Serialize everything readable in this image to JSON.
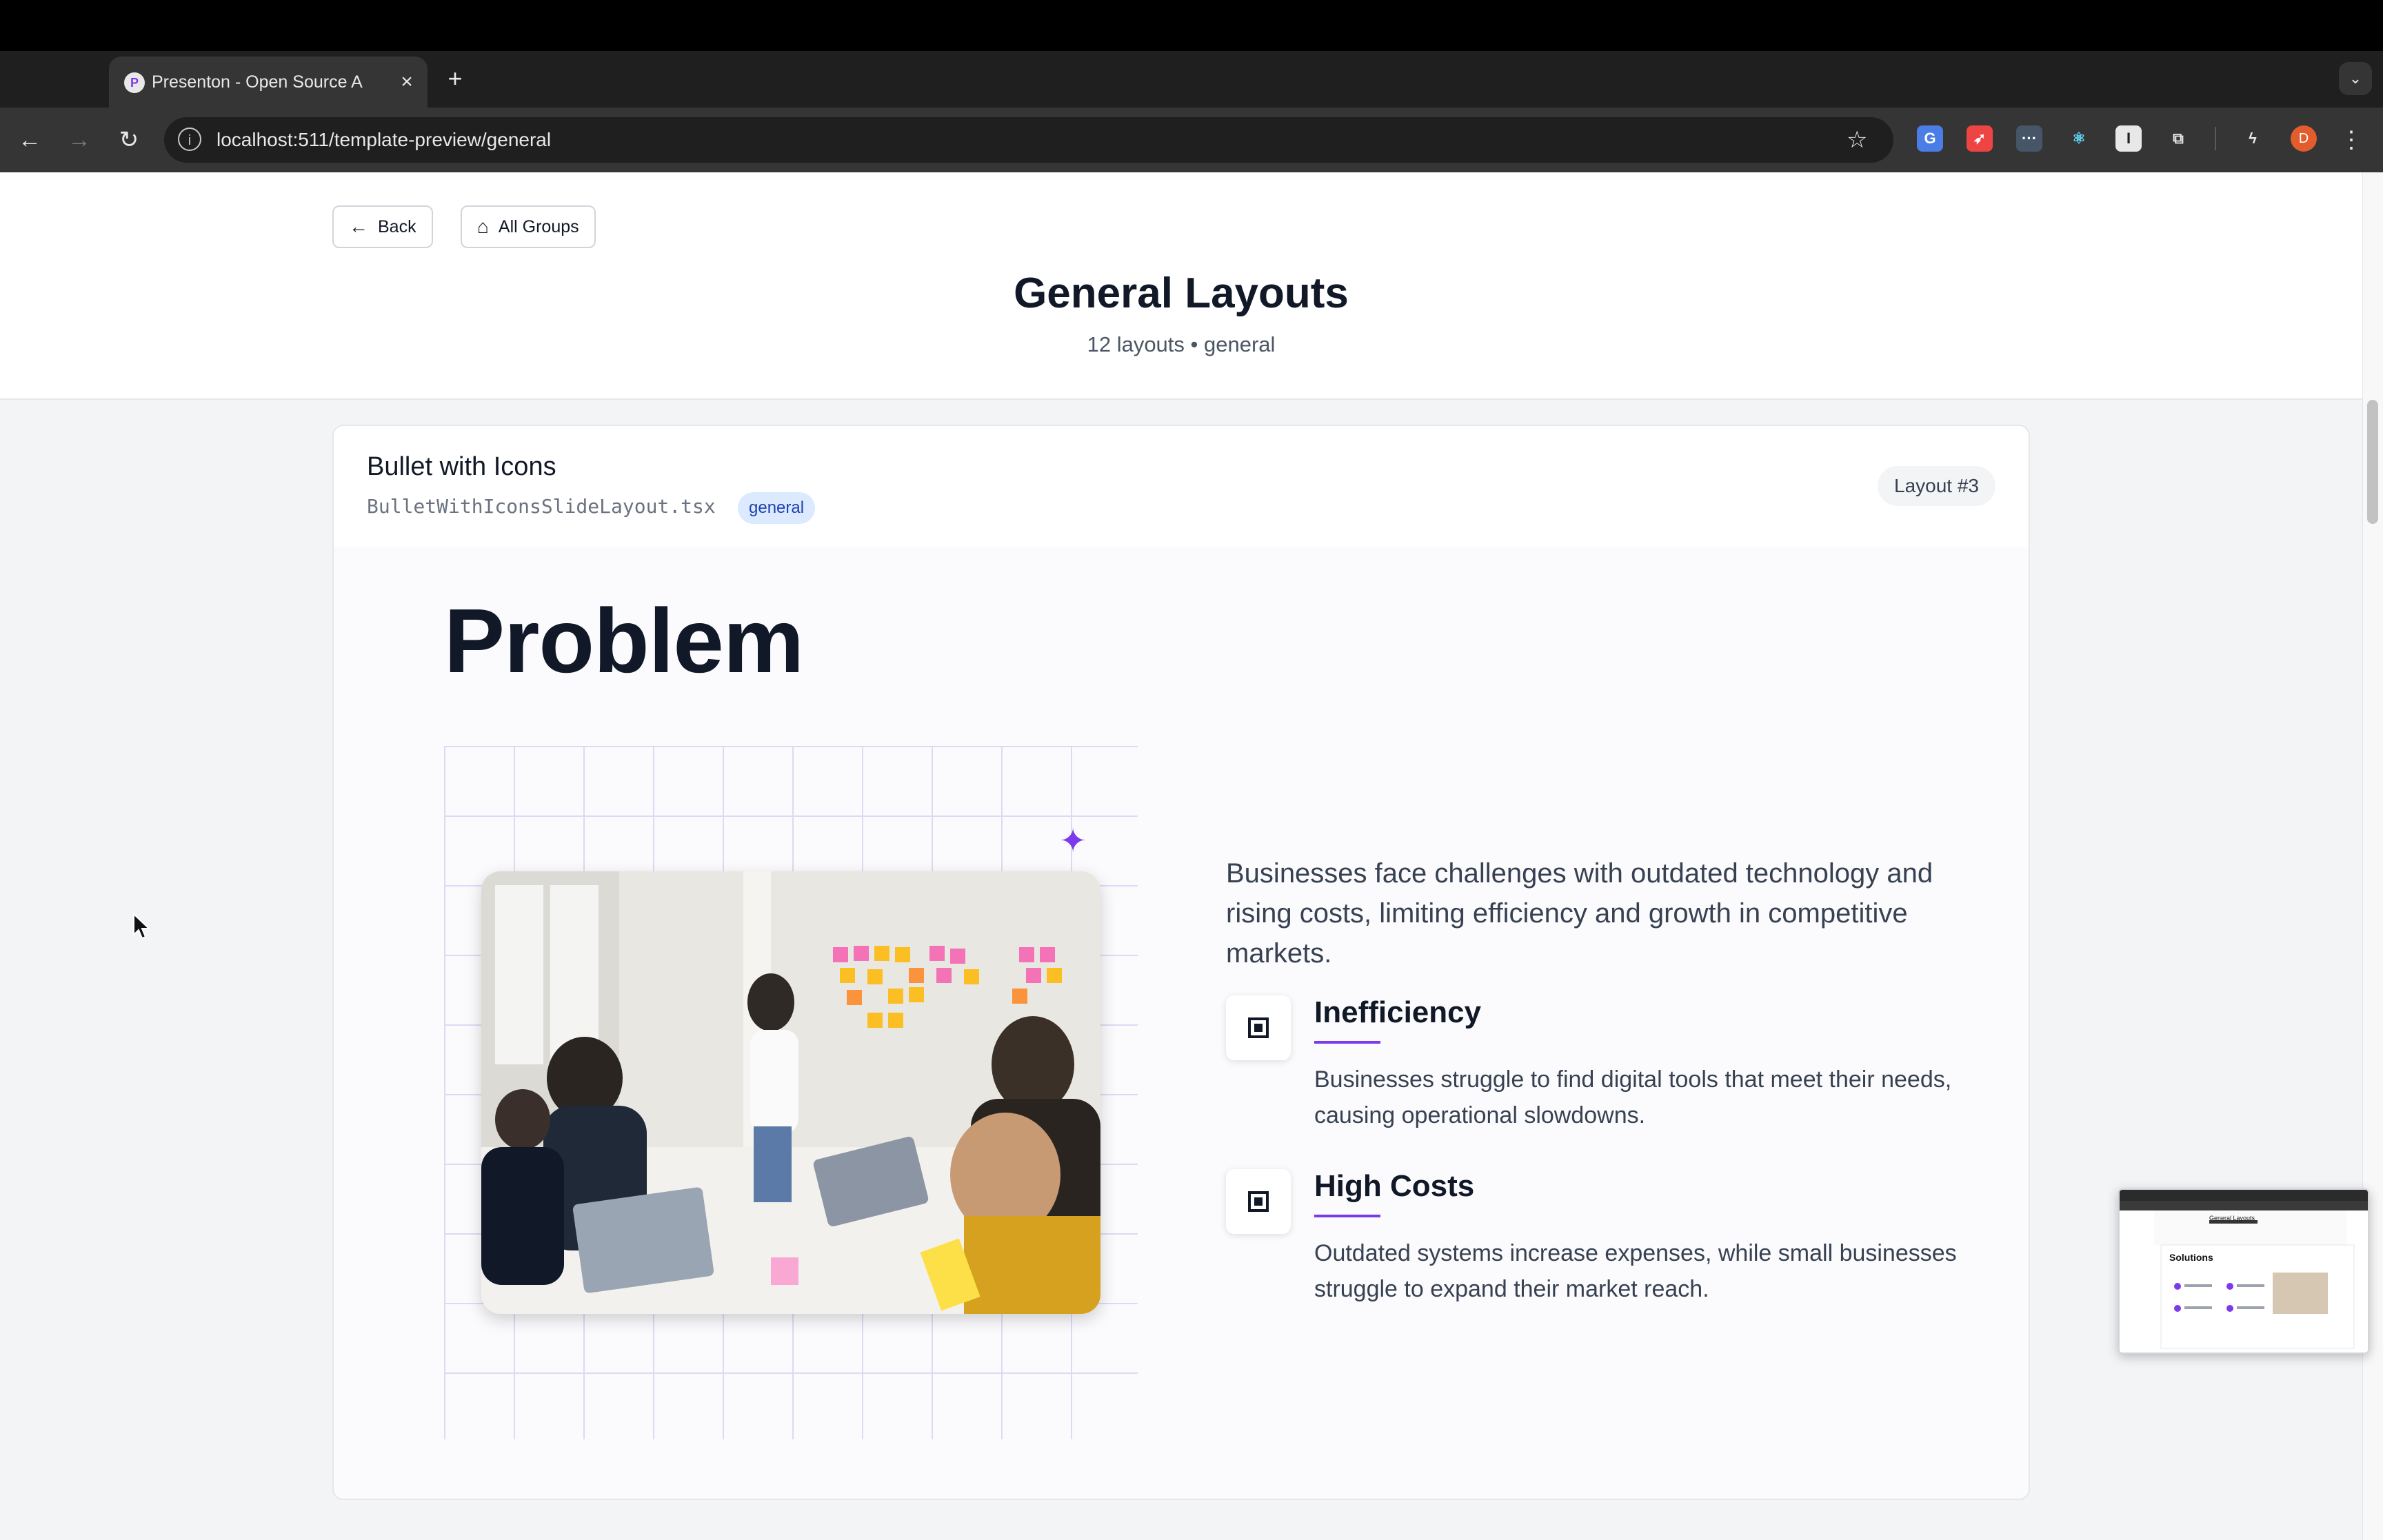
{
  "browser": {
    "tab_title": "Presenton - Open Source AI p",
    "favicon_letter": "P",
    "url": "localhost:511/template-preview/general",
    "avatar_letter": "D",
    "traffic_colors": [
      "#ff5f57",
      "#3a3a3a",
      "#28c840"
    ]
  },
  "header": {
    "back_label": "Back",
    "all_groups_label": "All Groups",
    "title": "General Layouts",
    "subtitle": "12 layouts • general"
  },
  "card": {
    "title": "Bullet with Icons",
    "file": "BulletWithIconsSlideLayout.tsx",
    "badge": "general",
    "layout_number": "Layout #3"
  },
  "slide": {
    "heading": "Problem",
    "description": "Businesses face challenges with outdated technology and rising costs, limiting efficiency and growth in competitive markets.",
    "bullets": [
      {
        "title": "Inefficiency",
        "text": "Businesses struggle to find digital tools that meet their needs, causing operational slowdowns."
      },
      {
        "title": "High Costs",
        "text": "Outdated systems increase expenses, while small businesses struggle to expand their market reach."
      }
    ]
  },
  "pip": {
    "heading": "Solutions",
    "title": "General Layouts"
  },
  "colors": {
    "accent": "#7c3aed",
    "badge_bg": "#dbeafe",
    "badge_text": "#1e40af"
  }
}
